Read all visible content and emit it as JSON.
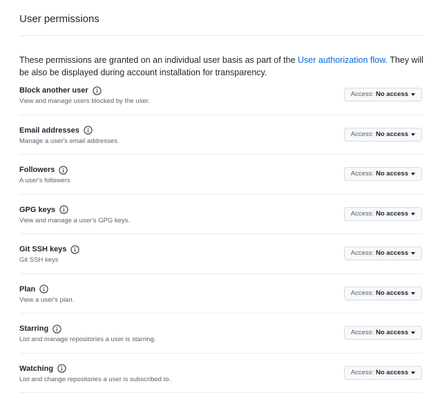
{
  "section": {
    "title": "User permissions",
    "intro_before": "These permissions are granted on an individual user basis as part of the ",
    "intro_link": "User authorization flow",
    "intro_after": ". They will be also be displayed during account installation for transparency."
  },
  "access_label": "Access:",
  "permissions": [
    {
      "name": "Block another user",
      "description": "View and manage users blocked by the user.",
      "access": "No access",
      "icon": "info-icon"
    },
    {
      "name": "Email addresses",
      "description": "Manage a user's email addresses.",
      "access": "No access",
      "icon": "info-icon"
    },
    {
      "name": "Followers",
      "description": "A user's followers",
      "access": "No access",
      "icon": "info-icon"
    },
    {
      "name": "GPG keys",
      "description": "View and manage a user's GPG keys.",
      "access": "No access",
      "icon": "info-icon"
    },
    {
      "name": "Git SSH keys",
      "description": "Git SSH keys",
      "access": "No access",
      "icon": "info-icon"
    },
    {
      "name": "Plan",
      "description": "View a user's plan.",
      "access": "No access",
      "icon": "info-icon"
    },
    {
      "name": "Starring",
      "description": "List and manage repositories a user is starring.",
      "access": "No access",
      "icon": "info-icon"
    },
    {
      "name": "Watching",
      "description": "List and change repositories a user is subscribed to.",
      "access": "No access",
      "icon": "info-icon"
    }
  ],
  "colors": {
    "link": "#0969da",
    "text": "#1f2328",
    "muted": "#59636e",
    "divider": "#e9ebee",
    "button_bg": "#f6f8fa"
  }
}
